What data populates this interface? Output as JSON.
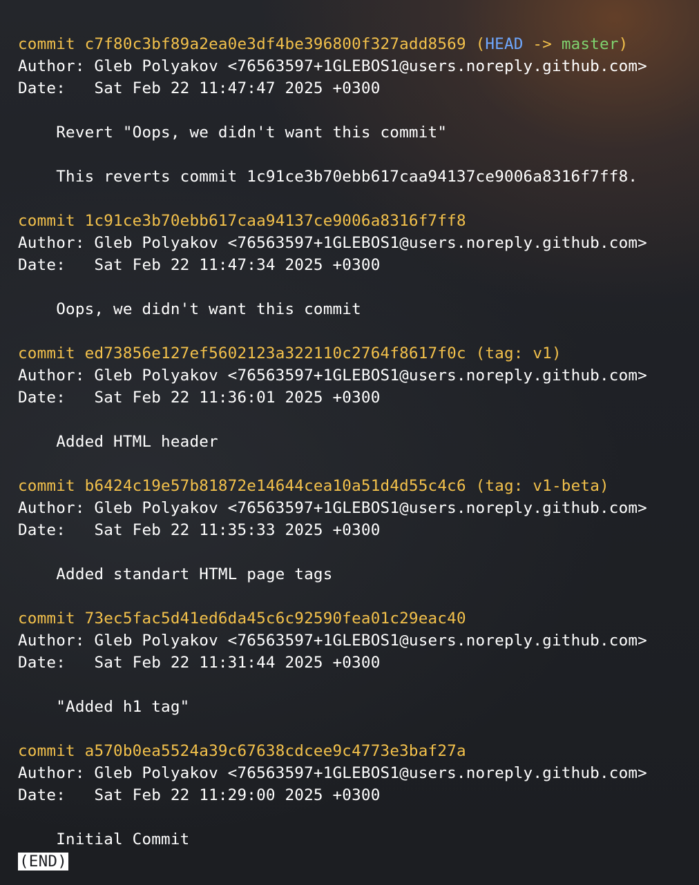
{
  "terminal": {
    "commits": [
      {
        "hash": "c7f80c3bf89a2ea0e3df4be396800f327add8569",
        "decoration": {
          "head": "HEAD",
          "arrow": "->",
          "branch": "master"
        },
        "author": "Gleb Polyakov <76563597+1GLEBOS1@users.noreply.github.com>",
        "date": "Sat Feb 22 11:47:47 2025 +0300",
        "message": [
          "Revert \"Oops, we didn't want this commit\"",
          "",
          "This reverts commit 1c91ce3b70ebb617caa94137ce9006a8316f7ff8."
        ]
      },
      {
        "hash": "1c91ce3b70ebb617caa94137ce9006a8316f7ff8",
        "author": "Gleb Polyakov <76563597+1GLEBOS1@users.noreply.github.com>",
        "date": "Sat Feb 22 11:47:34 2025 +0300",
        "message": [
          "Oops, we didn't want this commit"
        ]
      },
      {
        "hash": "ed73856e127ef5602123a322110c2764f8617f0c",
        "tag": "(tag: v1)",
        "author": "Gleb Polyakov <76563597+1GLEBOS1@users.noreply.github.com>",
        "date": "Sat Feb 22 11:36:01 2025 +0300",
        "message": [
          "Added HTML header"
        ]
      },
      {
        "hash": "b6424c19e57b81872e14644cea10a51d4d55c4c6",
        "tag": "(tag: v1-beta)",
        "author": "Gleb Polyakov <76563597+1GLEBOS1@users.noreply.github.com>",
        "date": "Sat Feb 22 11:35:33 2025 +0300",
        "message": [
          "Added standart HTML page tags"
        ]
      },
      {
        "hash": "73ec5fac5d41ed6da45c6c92590fea01c29eac40",
        "author": "Gleb Polyakov <76563597+1GLEBOS1@users.noreply.github.com>",
        "date": "Sat Feb 22 11:31:44 2025 +0300",
        "message": [
          "\"Added h1 tag\""
        ]
      },
      {
        "hash": "a570b0ea5524a39c67638cdcee9c4773e3baf27a",
        "author": "Gleb Polyakov <76563597+1GLEBOS1@users.noreply.github.com>",
        "date": "Sat Feb 22 11:29:00 2025 +0300",
        "message": [
          "Initial Commit"
        ]
      }
    ],
    "labels": {
      "commit": "commit",
      "author": "Author:",
      "date": "Date:"
    },
    "end_marker": "(END)",
    "colors": {
      "commit_hash": "#f3c14b",
      "head_ref": "#6fa8ff",
      "branch_ref": "#7fd36f",
      "text": "#ffffff"
    }
  }
}
